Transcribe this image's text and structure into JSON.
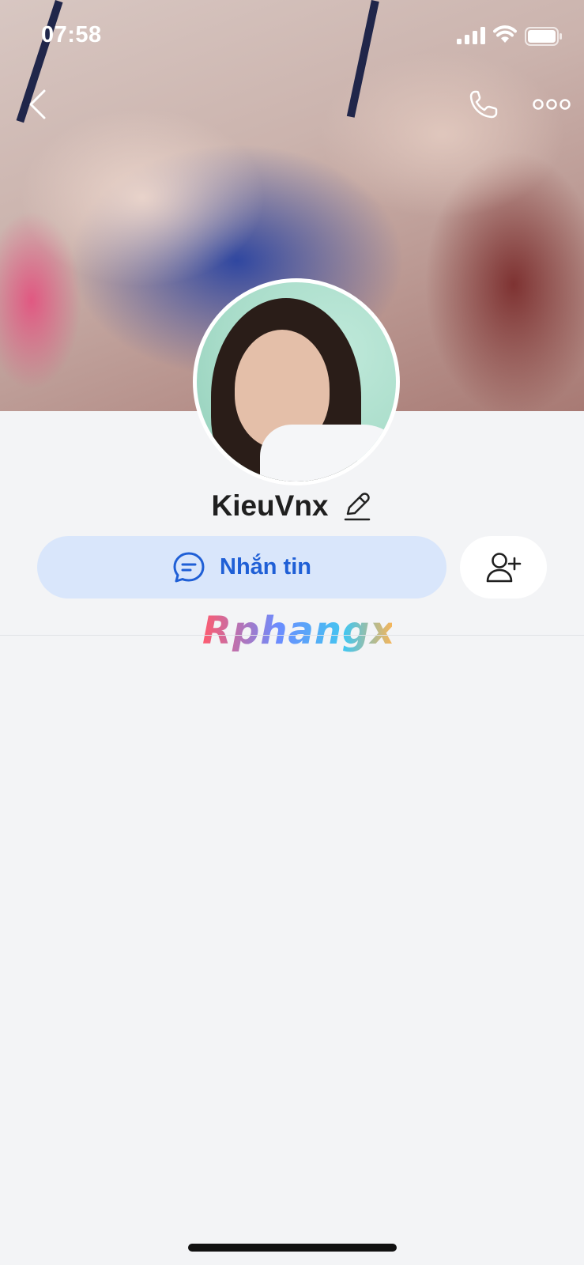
{
  "status_bar": {
    "time": "07:58"
  },
  "nav": {
    "back_icon": "chevron-left-icon",
    "call_icon": "phone-icon",
    "more_icon": "more-horizontal-icon"
  },
  "profile": {
    "name": "KieuVnx",
    "edit_icon": "pencil-icon"
  },
  "actions": {
    "message_label": "Nhắn tin",
    "message_icon": "chat-bubble-icon",
    "add_friend_icon": "add-user-icon"
  },
  "watermark": {
    "text": "Rphangx"
  },
  "colors": {
    "accent": "#1f5fd6",
    "message_button_bg": "#d9e6fb",
    "page_bg": "#f3f4f6"
  }
}
